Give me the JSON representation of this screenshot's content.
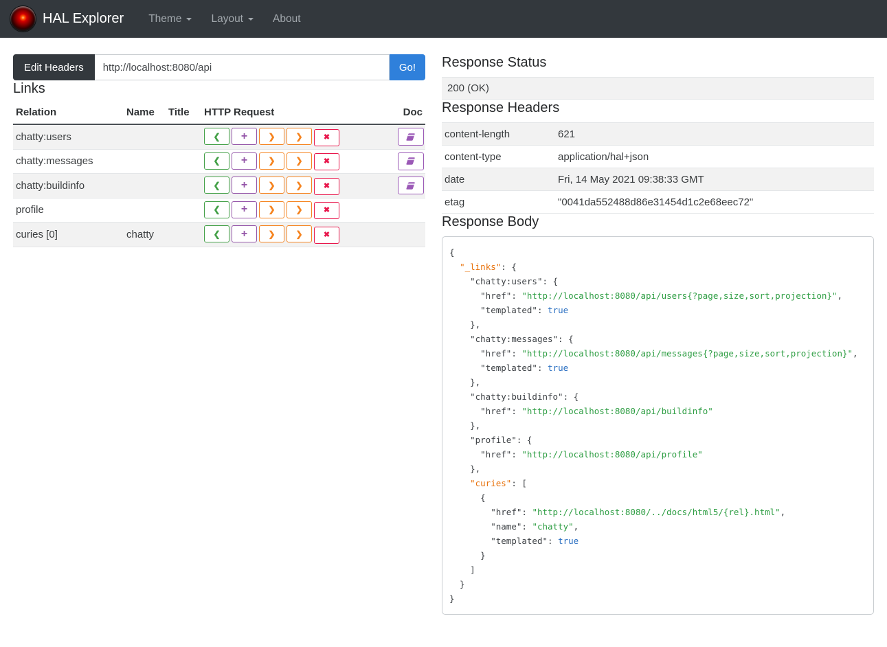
{
  "navbar": {
    "brand": "HAL Explorer",
    "items": [
      {
        "label": "Theme",
        "has_dropdown": true
      },
      {
        "label": "Layout",
        "has_dropdown": true
      },
      {
        "label": "About",
        "has_dropdown": false
      }
    ]
  },
  "request_bar": {
    "edit_headers_label": "Edit Headers",
    "url_value": "http://localhost:8080/api",
    "go_label": "Go!"
  },
  "links_section": {
    "title": "Links",
    "columns": [
      "Relation",
      "Name",
      "Title",
      "HTTP Request",
      "Doc"
    ],
    "http_buttons": [
      {
        "name": "get-button",
        "glyph": "❮",
        "cls": "chev",
        "color": "#43a047"
      },
      {
        "name": "post-button",
        "glyph": "+",
        "cls": "plus",
        "color": "#9455a8"
      },
      {
        "name": "put-button",
        "glyph": "❯",
        "cls": "chev",
        "color": "#f5831f"
      },
      {
        "name": "patch-button",
        "glyph": "❯",
        "cls": "chev",
        "color": "#f5831f"
      },
      {
        "name": "delete-button",
        "glyph": "✖",
        "cls": "x",
        "color": "#e8174c"
      }
    ],
    "doc_button_color": "#9b59b6",
    "rows": [
      {
        "relation": "chatty:users",
        "name": "",
        "title": "",
        "doc": true
      },
      {
        "relation": "chatty:messages",
        "name": "",
        "title": "",
        "doc": true
      },
      {
        "relation": "chatty:buildinfo",
        "name": "",
        "title": "",
        "doc": true
      },
      {
        "relation": "profile",
        "name": "",
        "title": "",
        "doc": false
      },
      {
        "relation": "curies [0]",
        "name": "chatty",
        "title": "",
        "doc": false
      }
    ]
  },
  "response_status": {
    "title": "Response Status",
    "value": "200 (OK)"
  },
  "response_headers": {
    "title": "Response Headers",
    "rows": [
      {
        "name": "content-length",
        "value": "621"
      },
      {
        "name": "content-type",
        "value": "application/hal+json"
      },
      {
        "name": "date",
        "value": "Fri, 14 May 2021 09:38:33 GMT"
      },
      {
        "name": "etag",
        "value": "\"0041da552488d86e31454d1c2e68eec72\""
      }
    ]
  },
  "response_body": {
    "title": "Response Body",
    "lines": [
      [
        [
          "p",
          "{"
        ]
      ],
      [
        [
          "p",
          "  "
        ],
        [
          "r",
          "\"_links\""
        ],
        [
          "p",
          ": {"
        ]
      ],
      [
        [
          "p",
          "    "
        ],
        [
          "k",
          "\"chatty:users\""
        ],
        [
          "p",
          ": {"
        ]
      ],
      [
        [
          "p",
          "      "
        ],
        [
          "k",
          "\"href\""
        ],
        [
          "p",
          ": "
        ],
        [
          "s",
          "\"http://localhost:8080/api/users{?page,size,sort,projection}\""
        ],
        [
          "p",
          ","
        ]
      ],
      [
        [
          "p",
          "      "
        ],
        [
          "k",
          "\"templated\""
        ],
        [
          "p",
          ": "
        ],
        [
          "b",
          "true"
        ]
      ],
      [
        [
          "p",
          "    },"
        ]
      ],
      [
        [
          "p",
          "    "
        ],
        [
          "k",
          "\"chatty:messages\""
        ],
        [
          "p",
          ": {"
        ]
      ],
      [
        [
          "p",
          "      "
        ],
        [
          "k",
          "\"href\""
        ],
        [
          "p",
          ": "
        ],
        [
          "s",
          "\"http://localhost:8080/api/messages{?page,size,sort,projection}\""
        ],
        [
          "p",
          ","
        ]
      ],
      [
        [
          "p",
          "      "
        ],
        [
          "k",
          "\"templated\""
        ],
        [
          "p",
          ": "
        ],
        [
          "b",
          "true"
        ]
      ],
      [
        [
          "p",
          "    },"
        ]
      ],
      [
        [
          "p",
          "    "
        ],
        [
          "k",
          "\"chatty:buildinfo\""
        ],
        [
          "p",
          ": {"
        ]
      ],
      [
        [
          "p",
          "      "
        ],
        [
          "k",
          "\"href\""
        ],
        [
          "p",
          ": "
        ],
        [
          "s",
          "\"http://localhost:8080/api/buildinfo\""
        ]
      ],
      [
        [
          "p",
          "    },"
        ]
      ],
      [
        [
          "p",
          "    "
        ],
        [
          "k",
          "\"profile\""
        ],
        [
          "p",
          ": {"
        ]
      ],
      [
        [
          "p",
          "      "
        ],
        [
          "k",
          "\"href\""
        ],
        [
          "p",
          ": "
        ],
        [
          "s",
          "\"http://localhost:8080/api/profile\""
        ]
      ],
      [
        [
          "p",
          "    },"
        ]
      ],
      [
        [
          "p",
          "    "
        ],
        [
          "r",
          "\"curies\""
        ],
        [
          "p",
          ": ["
        ]
      ],
      [
        [
          "p",
          "      {"
        ]
      ],
      [
        [
          "p",
          "        "
        ],
        [
          "k",
          "\"href\""
        ],
        [
          "p",
          ": "
        ],
        [
          "s",
          "\"http://localhost:8080/../docs/html5/{rel}.html\""
        ],
        [
          "p",
          ","
        ]
      ],
      [
        [
          "p",
          "        "
        ],
        [
          "k",
          "\"name\""
        ],
        [
          "p",
          ": "
        ],
        [
          "s",
          "\"chatty\""
        ],
        [
          "p",
          ","
        ]
      ],
      [
        [
          "p",
          "        "
        ],
        [
          "k",
          "\"templated\""
        ],
        [
          "p",
          ": "
        ],
        [
          "b",
          "true"
        ]
      ],
      [
        [
          "p",
          "      }"
        ]
      ],
      [
        [
          "p",
          "    ]"
        ]
      ],
      [
        [
          "p",
          "  }"
        ]
      ],
      [
        [
          "p",
          "}"
        ]
      ]
    ]
  }
}
